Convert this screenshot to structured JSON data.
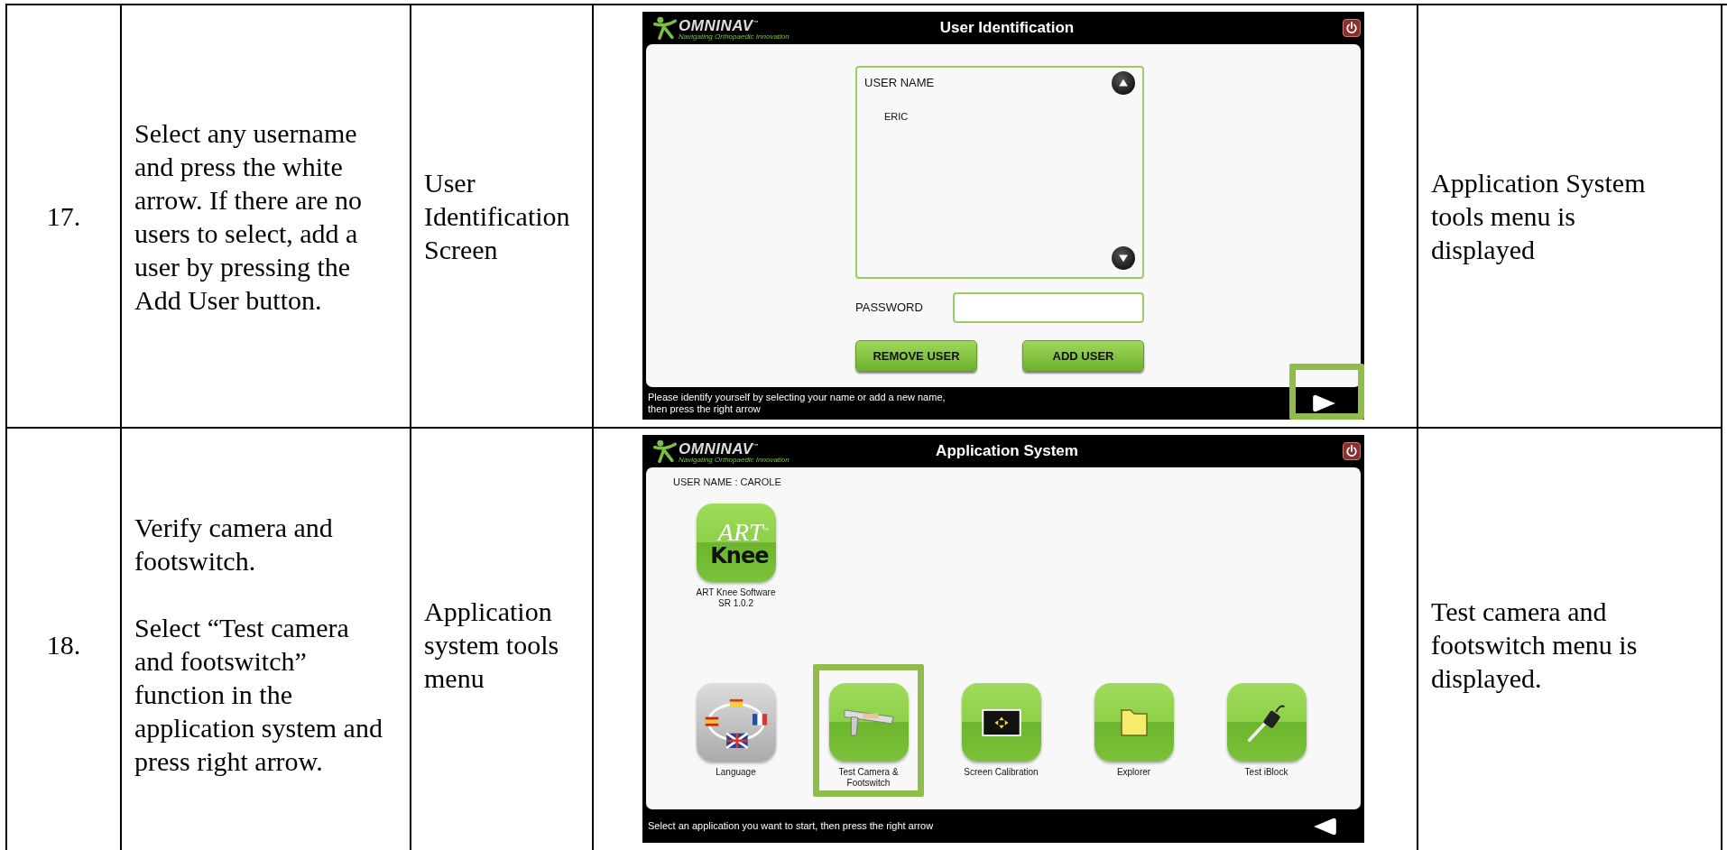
{
  "table": {
    "rows": [
      {
        "number": "17.",
        "instruction": [
          "Select any username and press the white arrow. If there are no users to select, add a user by pressing the Add User button."
        ],
        "screen_name": "User Identification Screen",
        "result": "Application System tools menu is displayed",
        "screen": {
          "kind": "user_identification",
          "logo": "OMNINAV",
          "logo_mark": "™",
          "tagline": "Navigating Orthopaedic Innovation",
          "title": "User Identification",
          "list_label": "USER NAME",
          "users": [
            "ERIC"
          ],
          "password_label": "PASSWORD",
          "buttons": [
            "REMOVE USER",
            "ADD USER"
          ],
          "footer": [
            "Please identify yourself by selecting your name or add a new name,",
            " then press the right arrow"
          ],
          "nav_arrow": {
            "kind": "right",
            "highlighted": true
          }
        }
      },
      {
        "number": "18.",
        "instruction": [
          "Verify camera and footswitch.",
          "Select “Test camera and footswitch” function in the application system and press right arrow."
        ],
        "screen_name": "Application system tools menu",
        "result": "Test camera and footswitch menu is displayed.",
        "screen": {
          "kind": "app_system",
          "logo": "OMNINAV",
          "logo_mark": "™",
          "tagline": "Navigating Orthopaedic Innovation",
          "title": "Application System",
          "user_line": "USER NAME : CAROLE",
          "main_app": {
            "logo_top": "ART",
            "logo_mark": "™",
            "logo_bottom": "Knee",
            "label": [
              "ART Knee Software",
              "SR 1.0.2"
            ]
          },
          "apps": [
            {
              "kind": "language",
              "label": [
                "Language"
              ],
              "selected": false
            },
            {
              "kind": "camera",
              "label": [
                "Test Camera &",
                "Footswitch"
              ],
              "selected": true
            },
            {
              "kind": "calibration",
              "label": [
                "Screen Calibration"
              ],
              "selected": false
            },
            {
              "kind": "folder",
              "label": [
                "Explorer"
              ],
              "selected": false
            },
            {
              "kind": "iblock",
              "label": [
                "Test iBlock"
              ],
              "selected": false
            }
          ],
          "footer": [
            "Select an application you want to start, then press the right arrow"
          ],
          "nav_arrow": {
            "kind": "left",
            "highlighted": false
          }
        }
      }
    ]
  }
}
